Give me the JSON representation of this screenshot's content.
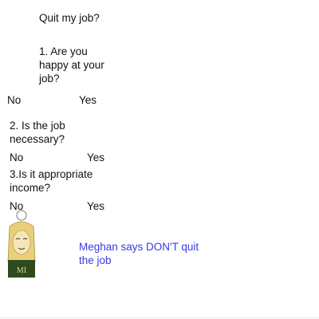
{
  "flow": {
    "title": "Quit my job?",
    "q1": {
      "text": "1. Are you\nhappy at your\njob?",
      "no": "No",
      "yes": "Yes"
    },
    "q2": {
      "text": "2. Is the job\nnecessary?",
      "no": "No",
      "yes": "Yes"
    },
    "q3": {
      "text": "3.Is it appropriate\nincome?",
      "no": "No",
      "yes": "Yes"
    },
    "verdict": "Meghan says DON'T quit\nthe job"
  },
  "avatar": {
    "icon": "girl-avatar-icon",
    "shirt_text": "MI"
  },
  "colors": {
    "text": "#111111",
    "verdict": "#3a3ae0",
    "hair": "#e8d07a",
    "shirt": "#2f4a1e"
  }
}
